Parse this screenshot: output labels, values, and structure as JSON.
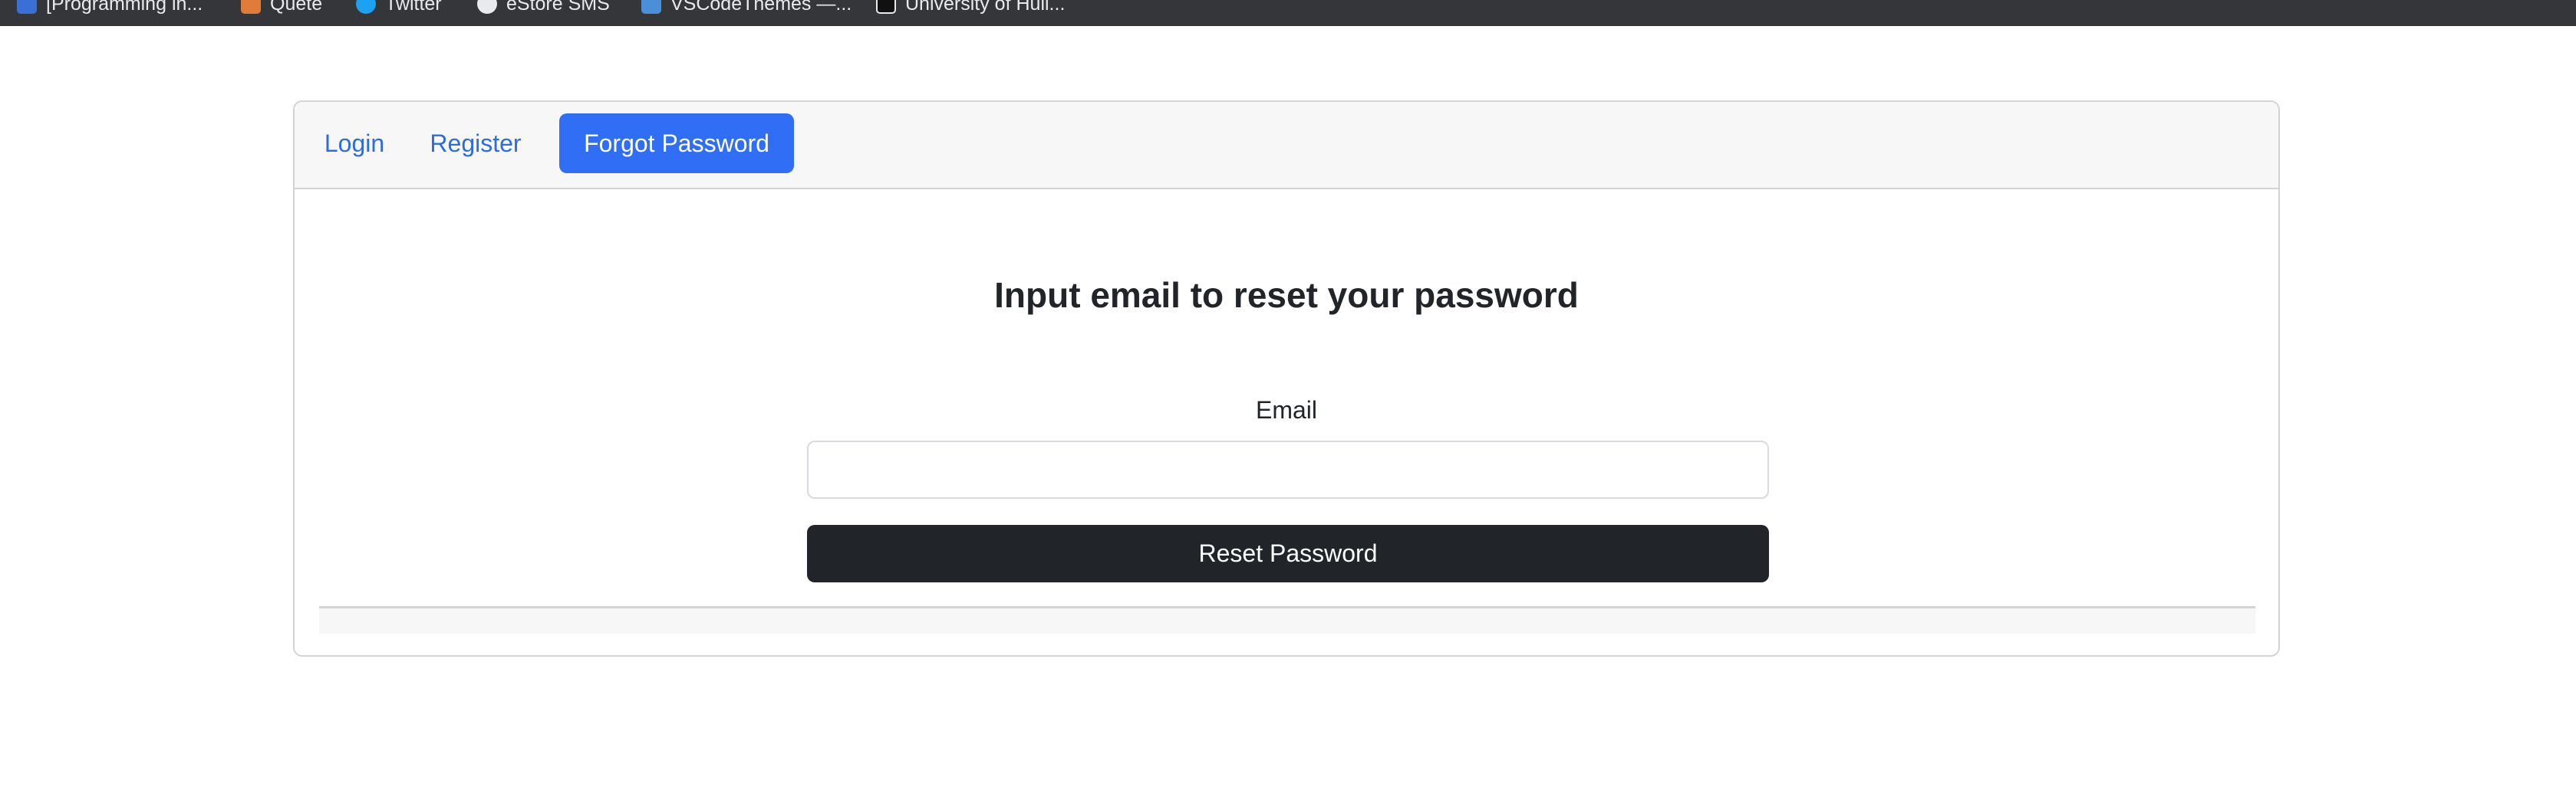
{
  "bookmarks": [
    {
      "label": "[Programming in...",
      "icon": "user-favicon-icon",
      "color": "#3b6fd8"
    },
    {
      "label": "Quete",
      "icon": "quete-favicon-icon",
      "color": "#e07b39"
    },
    {
      "label": "Twitter",
      "icon": "twitter-bird-icon",
      "color": "#1da1f2"
    },
    {
      "label": "eStore SMS",
      "icon": "globe-icon",
      "color": "#e8eaed"
    },
    {
      "label": "VSCodeThemes —...",
      "icon": "vscode-themes-icon",
      "color": "#4a90d9"
    },
    {
      "label": "University of Hull...",
      "icon": "university-crest-icon",
      "color": "#111111"
    }
  ],
  "tabs": {
    "login": "Login",
    "register": "Register",
    "forgot": "Forgot Password",
    "active": "forgot"
  },
  "form": {
    "title": "Input email to reset your password",
    "email_label": "Email",
    "email_value": "",
    "email_placeholder": "",
    "submit_label": "Reset Password"
  },
  "colors": {
    "accent": "#2f6ef5",
    "link": "#2c6ce0",
    "dark_button": "#212529",
    "bookmarks_bar": "#35363a"
  }
}
